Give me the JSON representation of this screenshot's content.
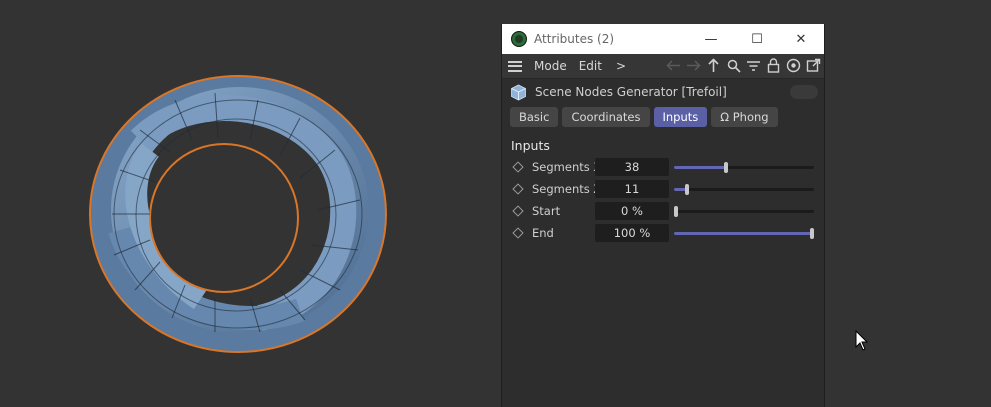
{
  "window": {
    "title": "Attributes (2)",
    "min_glyph": "—",
    "max_glyph": "☐",
    "close_glyph": "✕"
  },
  "menu": {
    "mode_label": "Mode",
    "edit_label": "Edit",
    "more_label": ">",
    "toolbar_icons": [
      "back-arrow-icon",
      "forward-arrow-icon",
      "up-arrow-icon",
      "search-icon",
      "filter-icon",
      "lock-icon",
      "target-icon",
      "open-new-window-icon"
    ]
  },
  "object": {
    "name": "Scene Nodes Generator [Trefoil]",
    "icon": "cube-icon"
  },
  "tabs": [
    {
      "label": "Basic",
      "active": false
    },
    {
      "label": "Coordinates",
      "active": false
    },
    {
      "label": "Inputs",
      "active": true
    },
    {
      "label": "Ω Phong",
      "active": false
    }
  ],
  "inputs": {
    "section_title": "Inputs",
    "params": [
      {
        "label": "Segments X",
        "value": "38",
        "slider_fraction": 0.37
      },
      {
        "label": "Segments Z",
        "value": "11",
        "slider_fraction": 0.09
      },
      {
        "label": "Start",
        "value": "0 %",
        "slider_fraction": 0.0
      },
      {
        "label": "End",
        "value": "100 %",
        "slider_fraction": 1.0
      }
    ]
  },
  "colors": {
    "viewport_bg": "#333333",
    "accent": "#5b5fa6",
    "knot_fill": "#6a8cb1",
    "knot_outline": "#d97628"
  }
}
